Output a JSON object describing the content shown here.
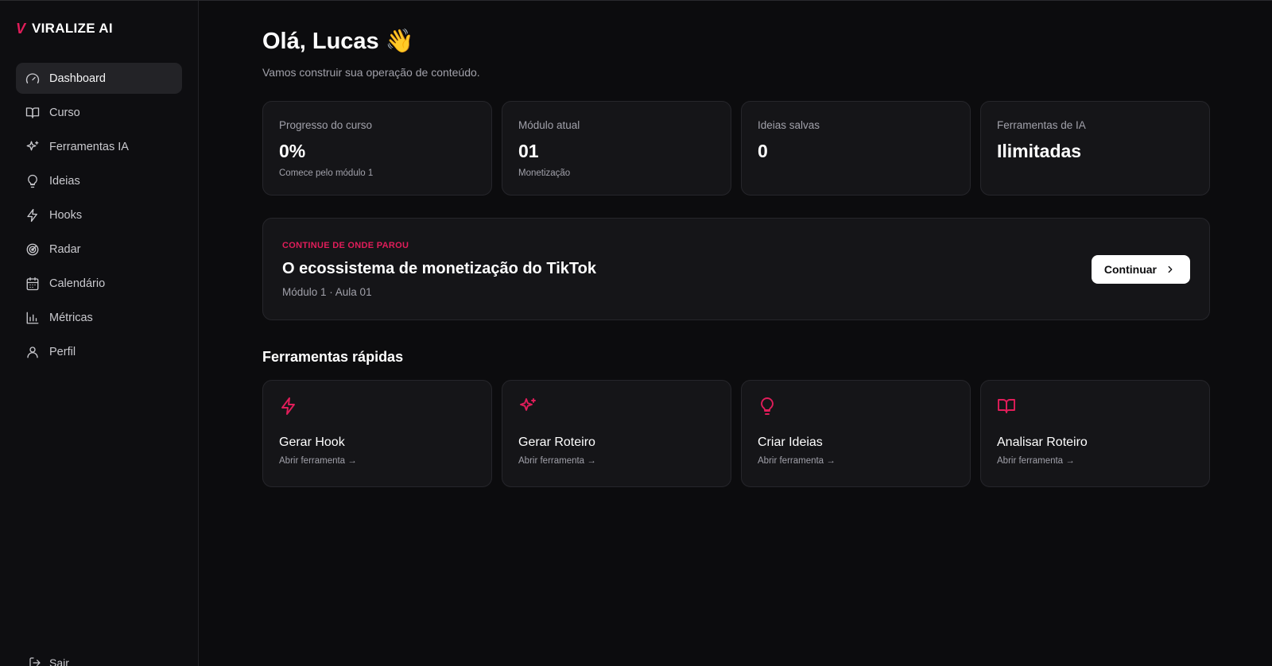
{
  "brand": {
    "mark": "V",
    "name": "VIRALIZE AI"
  },
  "sidebar": {
    "items": [
      {
        "label": "Dashboard",
        "icon": "gauge-icon"
      },
      {
        "label": "Curso",
        "icon": "book-icon"
      },
      {
        "label": "Ferramentas IA",
        "icon": "sparkles-icon"
      },
      {
        "label": "Ideias",
        "icon": "lightbulb-icon"
      },
      {
        "label": "Hooks",
        "icon": "zap-icon"
      },
      {
        "label": "Radar",
        "icon": "radar-icon"
      },
      {
        "label": "Calendário",
        "icon": "calendar-icon"
      },
      {
        "label": "Métricas",
        "icon": "bar-chart-icon"
      },
      {
        "label": "Perfil",
        "icon": "user-icon"
      }
    ],
    "active": "Dashboard",
    "logout_label": "Sair"
  },
  "header": {
    "greeting": "Olá, Lucas",
    "emoji": "👋",
    "subtitle": "Vamos construir sua operação de conteúdo."
  },
  "stats": [
    {
      "label": "Progresso do curso",
      "value": "0%",
      "hint": "Comece pelo módulo 1"
    },
    {
      "label": "Módulo atual",
      "value": "01",
      "hint": "Monetização"
    },
    {
      "label": "Ideias salvas",
      "value": "0",
      "hint": ""
    },
    {
      "label": "Ferramentas de IA",
      "value": "Ilimitadas",
      "hint": ""
    }
  ],
  "continue": {
    "tag": "CONTINUE DE ONDE PAROU",
    "title": "O ecossistema de monetização do TikTok",
    "meta": "Módulo 1 · Aula 01",
    "button_label": "Continuar"
  },
  "quick_tools": {
    "title": "Ferramentas rápidas",
    "items": [
      {
        "name": "Gerar Hook",
        "link": "Abrir ferramenta →",
        "icon": "zap-icon"
      },
      {
        "name": "Gerar Roteiro",
        "link": "Abrir ferramenta →",
        "icon": "sparkles-icon"
      },
      {
        "name": "Criar Ideias",
        "link": "Abrir ferramenta →",
        "icon": "lightbulb-icon"
      },
      {
        "name": "Analisar Roteiro",
        "link": "Abrir ferramenta →",
        "icon": "book-icon"
      }
    ]
  },
  "colors": {
    "accent": "#e11d5a",
    "background": "#0c0c0e",
    "card": "#151518"
  }
}
